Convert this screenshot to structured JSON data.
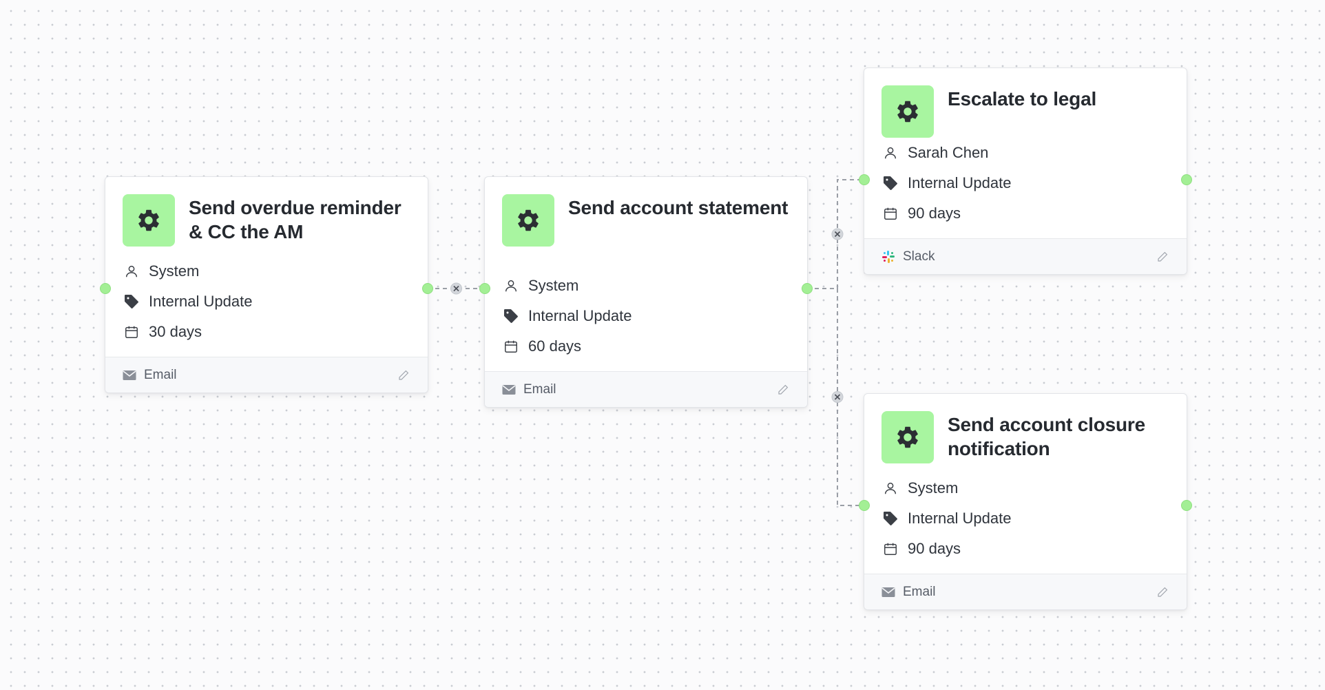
{
  "nodes": [
    {
      "id": "n1",
      "title": "Send overdue reminder & CC the AM",
      "assignee": "System",
      "tag": "Internal Update",
      "duration": "30 days",
      "channel": "Email",
      "channel_icon": "envelope-icon",
      "icon": "gear-icon"
    },
    {
      "id": "n2",
      "title": "Send account statement",
      "assignee": "System",
      "tag": "Internal Update",
      "duration": "60 days",
      "channel": "Email",
      "channel_icon": "envelope-icon",
      "icon": "gear-icon"
    },
    {
      "id": "n3",
      "title": "Escalate to legal",
      "assignee": "Sarah Chen",
      "tag": "Internal Update",
      "duration": "90 days",
      "channel": "Slack",
      "channel_icon": "slack-icon",
      "icon": "gear-icon"
    },
    {
      "id": "n4",
      "title": "Send account closure notification",
      "assignee": "System",
      "tag": "Internal Update",
      "duration": "90 days",
      "channel": "Email",
      "channel_icon": "envelope-icon",
      "icon": "gear-icon"
    }
  ],
  "edges": [
    {
      "from": "n1",
      "to": "n2",
      "style": "dashed",
      "delete_icon": "close-icon"
    },
    {
      "from": "n2",
      "to": "n3",
      "style": "dashed",
      "delete_icon": "close-icon"
    },
    {
      "from": "n2",
      "to": "n4",
      "style": "dashed",
      "delete_icon": "close-icon"
    }
  ],
  "colors": {
    "node_icon_bg": "#a8f5a0",
    "handle": "#a3ef95",
    "edge": "#9a9ea6",
    "canvas_dot": "#c9ccd2"
  }
}
